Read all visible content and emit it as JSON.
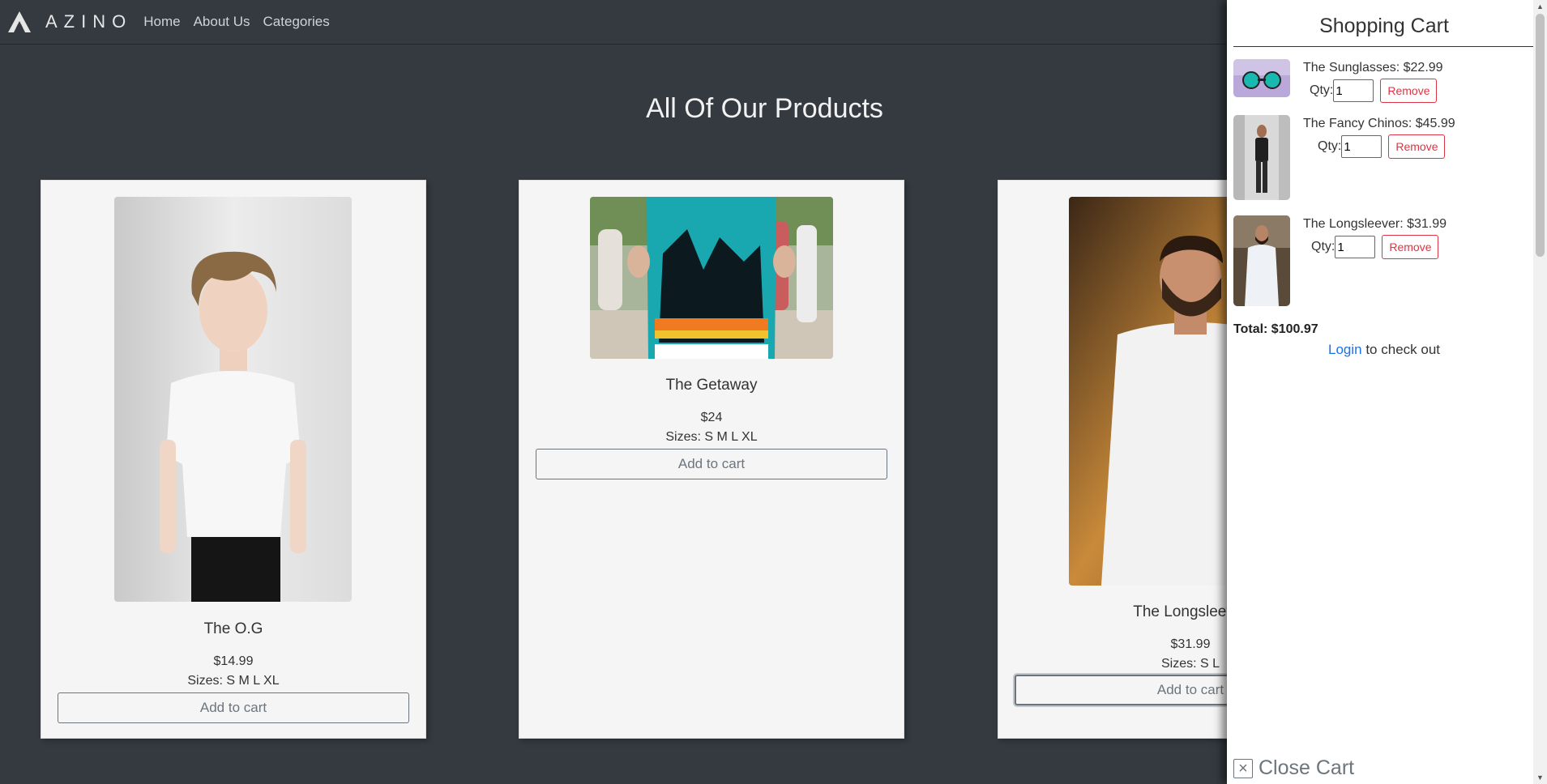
{
  "nav": {
    "brand": "AZINO",
    "links": [
      "Home",
      "About Us",
      "Categories"
    ]
  },
  "page_title": "All Of Our Products",
  "products": [
    {
      "name": "The O.G",
      "price": "$14.99",
      "sizes": "Sizes: S M L XL",
      "button": "Add to cart"
    },
    {
      "name": "The Getaway",
      "price": "$24",
      "sizes": "Sizes: S M L XL",
      "button": "Add to cart"
    },
    {
      "name": "The Longsleever",
      "price": "$31.99",
      "sizes": "Sizes: S L",
      "button": "Add to cart"
    }
  ],
  "cart": {
    "title": "Shopping Cart",
    "qty_label": "Qty:",
    "remove_label": "Remove",
    "items": [
      {
        "label": "The Sunglasses: $22.99",
        "qty": "1"
      },
      {
        "label": "The Fancy Chinos: $45.99",
        "qty": "1"
      },
      {
        "label": "The Longsleever: $31.99",
        "qty": "1"
      }
    ],
    "total": "Total: $100.97",
    "login_link": "Login",
    "checkout_text": " to check out",
    "close_label": "Close Cart"
  },
  "colors": {
    "background": "#343a40",
    "card": "#f5f5f5",
    "danger": "#dc3545",
    "link": "#1a73e8"
  }
}
